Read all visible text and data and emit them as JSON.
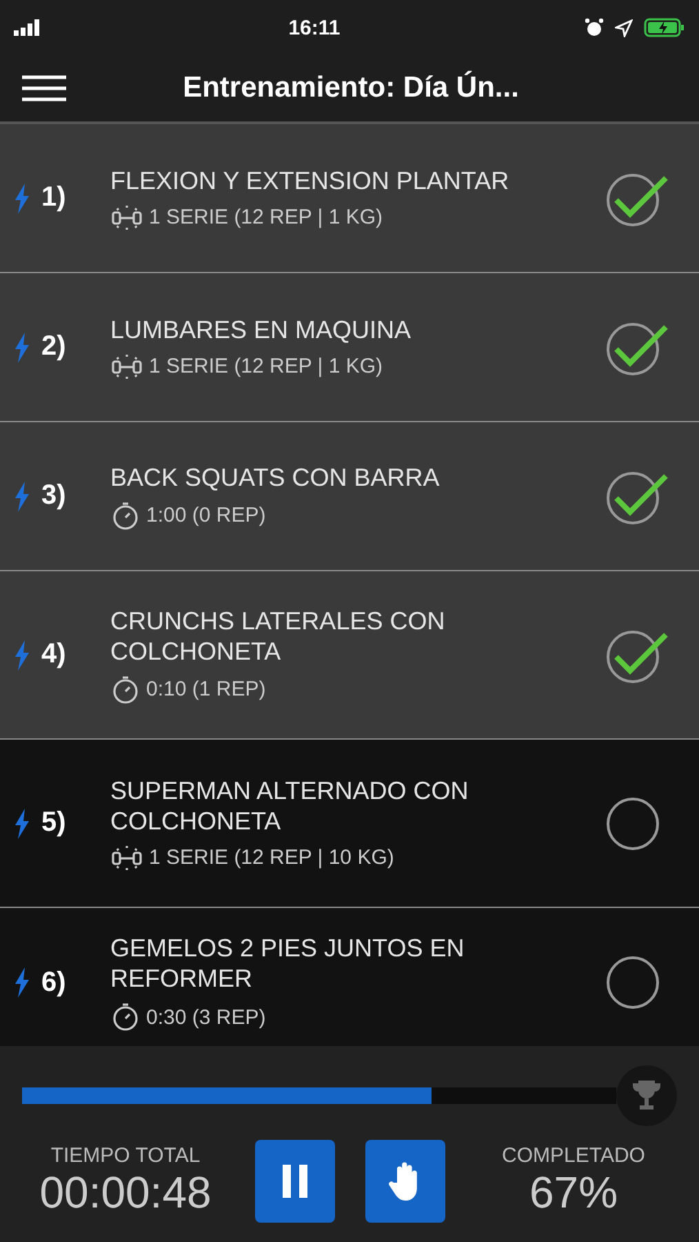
{
  "status_bar": {
    "time": "16:11"
  },
  "nav": {
    "title": "Entrenamiento: Día Ún..."
  },
  "exercises": [
    {
      "number": "1)",
      "name": "FLEXION Y EXTENSION PLANTAR",
      "kind": "weights",
      "detail": "1 SERIE (12 REP | 1 KG)",
      "done": true
    },
    {
      "number": "2)",
      "name": "LUMBARES EN MAQUINA",
      "kind": "weights",
      "detail": "1 SERIE (12 REP | 1 KG)",
      "done": true
    },
    {
      "number": "3)",
      "name": "BACK SQUATS CON BARRA",
      "kind": "timer",
      "detail": "1:00 (0 REP)",
      "done": true
    },
    {
      "number": "4)",
      "name": "CRUNCHS LATERALES CON COLCHONETA",
      "kind": "timer",
      "detail": "0:10 (1 REP)",
      "done": true
    },
    {
      "number": "5)",
      "name": "SUPERMAN ALTERNADO CON COLCHONETA",
      "kind": "weights",
      "detail": "1 SERIE (12 REP | 10 KG)",
      "done": false
    },
    {
      "number": "6)",
      "name": "GEMELOS 2 PIES JUNTOS EN REFORMER",
      "kind": "timer",
      "detail": "0:30 (3 REP)",
      "done": false
    }
  ],
  "footer": {
    "progress": {
      "level": 0.69
    },
    "total_label": "TIEMPO TOTAL",
    "total_time": "00:00:48",
    "completed_label": "COMPLETADO",
    "completed_value": "67%"
  }
}
